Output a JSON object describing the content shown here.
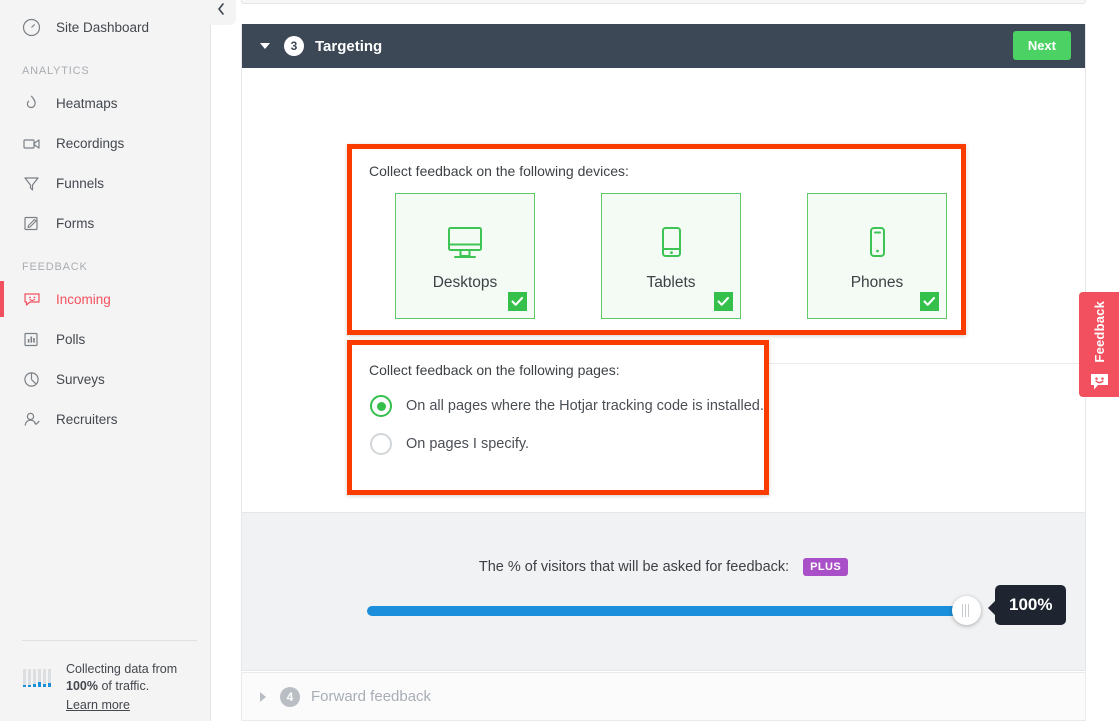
{
  "sidebar": {
    "collapse_icon": "chevron-left-icon",
    "top_items": [
      {
        "label": "Site Dashboard",
        "icon": "gauge-icon",
        "active": false
      }
    ],
    "sections": [
      {
        "title": "ANALYTICS",
        "items": [
          {
            "label": "Heatmaps",
            "icon": "flame-icon",
            "active": false
          },
          {
            "label": "Recordings",
            "icon": "video-camera-icon",
            "active": false
          },
          {
            "label": "Funnels",
            "icon": "funnel-icon",
            "active": false
          },
          {
            "label": "Forms",
            "icon": "form-pencil-icon",
            "active": false
          }
        ]
      },
      {
        "title": "FEEDBACK",
        "items": [
          {
            "label": "Incoming",
            "icon": "feedback-smiley-icon",
            "active": true
          },
          {
            "label": "Polls",
            "icon": "bar-chart-icon",
            "active": false
          },
          {
            "label": "Surveys",
            "icon": "pie-chart-icon",
            "active": false
          },
          {
            "label": "Recruiters",
            "icon": "user-check-icon",
            "active": false
          }
        ]
      }
    ],
    "footer": {
      "line1": "Collecting data from",
      "percent": "100%",
      "line2_suffix": " of traffic.",
      "link": "Learn more",
      "icon": "bar-sparkline-icon"
    }
  },
  "card": {
    "step_number": "3",
    "title": "Targeting",
    "next_label": "Next",
    "caret_icon": "caret-down-icon",
    "devices": {
      "label": "Collect feedback on the following devices:",
      "items": [
        {
          "name": "Desktops",
          "icon": "desktop-monitor-icon",
          "selected": true,
          "check_icon": "check-icon"
        },
        {
          "name": "Tablets",
          "icon": "tablet-icon",
          "selected": true,
          "check_icon": "check-icon"
        },
        {
          "name": "Phones",
          "icon": "phone-icon",
          "selected": true,
          "check_icon": "check-icon"
        }
      ]
    },
    "pages": {
      "label": "Collect feedback on the following pages:",
      "options": [
        {
          "label": "On all pages where the Hotjar tracking code is installed.",
          "selected": true
        },
        {
          "label": "On pages I specify.",
          "selected": false
        }
      ]
    },
    "slider": {
      "caption": "The % of visitors that will be asked for feedback:",
      "badge": "PLUS",
      "value": "100%",
      "percent": 100,
      "fill_color": "#1b8fdb",
      "track_color": "#dfe1e4"
    }
  },
  "next_card": {
    "step_number": "4",
    "title": "Forward feedback",
    "caret_icon": "caret-right-icon"
  },
  "feedback_tab": {
    "label": "Feedback",
    "icon": "feedback-smiley-icon",
    "color": "#f3505f"
  },
  "colors": {
    "header_bg": "#3c4856",
    "accent_green": "#35c04b",
    "next_green": "#4cd264",
    "highlight_red": "#fa3c00",
    "sidebar_active": "#f3505f",
    "plus_purple": "#a950c8",
    "slider_blue": "#1b8fdb"
  }
}
